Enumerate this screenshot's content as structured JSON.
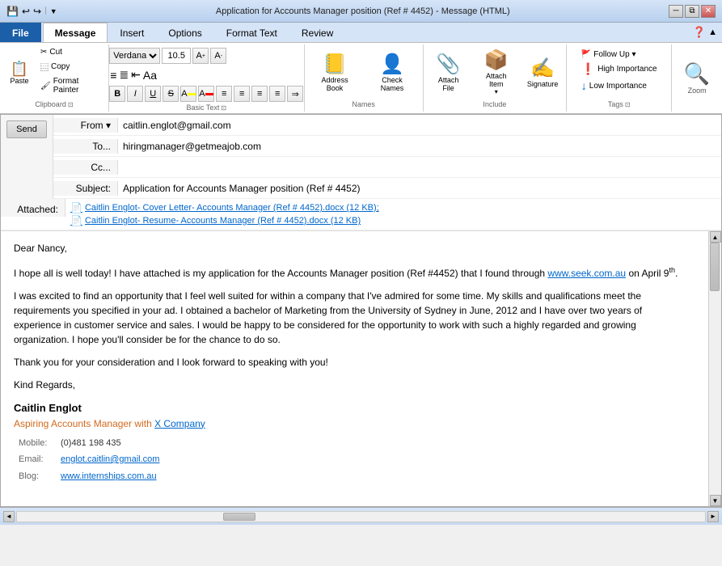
{
  "window": {
    "title": "Application for Accounts Manager position (Ref # 4452)  -  Message (HTML)",
    "min": "🗕",
    "restore": "🗗",
    "close": "✕"
  },
  "qat": {
    "save": "💾",
    "undo": "↩",
    "redo": "↪",
    "separator": "|",
    "dropdown": "▼"
  },
  "tabs": {
    "file": "File",
    "message": "Message",
    "insert": "Insert",
    "options": "Options",
    "format_text": "Format Text",
    "review": "Review"
  },
  "ribbon": {
    "clipboard": {
      "label": "Clipboard",
      "paste": "Paste",
      "cut": "Cut",
      "copy": "Copy",
      "format_painter": "Format Painter"
    },
    "basic_text": {
      "label": "Basic Text",
      "font": "Verdana",
      "size": "10.5",
      "bold": "B",
      "italic": "I",
      "underline": "U"
    },
    "names": {
      "label": "Names",
      "address_book": "Address Book",
      "check_names": "Check Names"
    },
    "include": {
      "label": "Include",
      "attach_file": "Attach File",
      "attach_item": "Attach Item",
      "signature": "Signature"
    },
    "tags": {
      "label": "Tags",
      "follow_up": "Follow Up ▾",
      "high_importance": "High Importance",
      "low_importance": "Low Importance"
    },
    "zoom": {
      "label": "Zoom",
      "icon": "🔍"
    }
  },
  "message": {
    "from_label": "From ▾",
    "from_value": "caitlin.englot@gmail.com",
    "to_label": "To...",
    "to_value": "hiringmanager@getmeajob.com",
    "cc_label": "Cc...",
    "cc_value": "",
    "subject_label": "Subject:",
    "subject_value": "Application for Accounts Manager position (Ref # 4452)",
    "attached_label": "Attached:",
    "attachment1": "Caitlin Englot- Cover Letter- Accounts Manager (Ref # 4452).docx (12 KB);",
    "attachment2": "Caitlin Englot- Resume- Accounts Manager (Ref # 4452).docx (12 KB)",
    "send": "Send"
  },
  "body": {
    "greeting": "Dear Nancy,",
    "p1_start": "I hope all is well today! I have attached is my application for the Accounts Manager position (Ref #4452) that I found through ",
    "p1_link": "www.seek.com.au",
    "p1_date": " on April 9",
    "p1_super": "th",
    "p1_end": ".",
    "p2": "I was excited to find an opportunity that I feel well suited for within a company that I've admired for some time. My skills and qualifications meet the requirements you specified in your ad. I obtained a bachelor of Marketing from the University of Sydney in June, 2012 and I have over two years of experience in customer service and sales. I would be happy to be considered for the opportunity to work with such a highly regarded and growing organization. I hope you'll consider be for the chance to do so.",
    "p3": "Thank you for your consideration and I look forward to speaking with you!",
    "regards": "Kind Regards,",
    "sig_name": "Caitlin Englot",
    "sig_title_start": "Aspiring Accounts Manager with ",
    "sig_title_link": "X Company",
    "mobile_label": "Mobile:",
    "mobile_value": "(0)481 198 435",
    "email_label": "Email:",
    "email_value": "englot.caitlin@gmail.com",
    "blog_label": "Blog:",
    "blog_value": "www.internships.com.au"
  }
}
